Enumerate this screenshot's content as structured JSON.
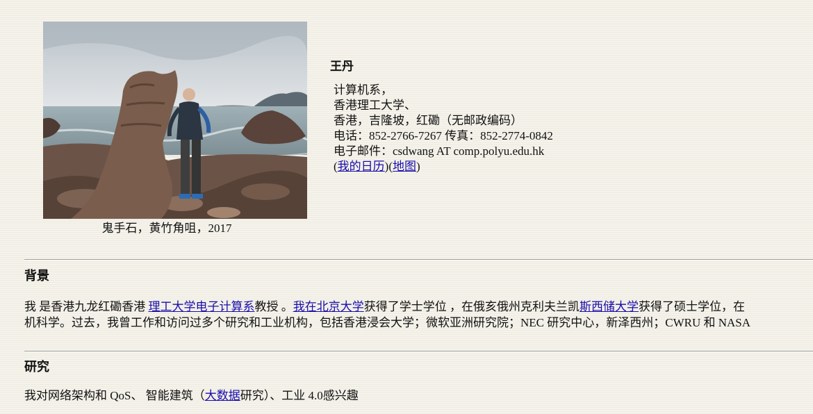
{
  "photo": {
    "caption": "鬼手石，黄竹角咀，2017",
    "colors": {
      "sky": "#cfd4d8",
      "sea": "#8fa0a6",
      "rock": "#6b5447"
    }
  },
  "contact": {
    "name": "王丹",
    "department": "计算机系，",
    "university": "香港理工大学、",
    "address": "香港，吉隆坡，红磡（无邮政编码）",
    "phone_fax": "电话：852-2766-7267 传真：852-2774-0842",
    "email": "电子邮件：csdwang AT comp.polyu.edu.hk",
    "calendar_link": "我的日历",
    "map_link": "地图",
    "paren_open": "(",
    "paren_mid": ")(",
    "paren_close": ")"
  },
  "background": {
    "title": "背景",
    "l1_a": "我 是香港九龙红磡香港 ",
    "l1_link1": "理工大学电子计算系",
    "l1_b": "教授 。",
    "l1_link2": "我在北京大学",
    "l1_c": "获得了学士学位 ，在俄亥俄州克利夫兰凯",
    "l1_link3": "斯西储大学",
    "l1_d": "获得了硕士学位，在",
    "l2": "机科学。过去，我曾工作和访问过多个研究和工业机构，包括香港浸会大学；微软亚洲研究院；NEC 研究中心，新泽西州；CWRU 和 NASA"
  },
  "research": {
    "title": "研究",
    "a": "我对网络架构和 QoS、 智能建筑（",
    "link": "大数据",
    "b": "研究）、工业 4.0感兴趣"
  }
}
